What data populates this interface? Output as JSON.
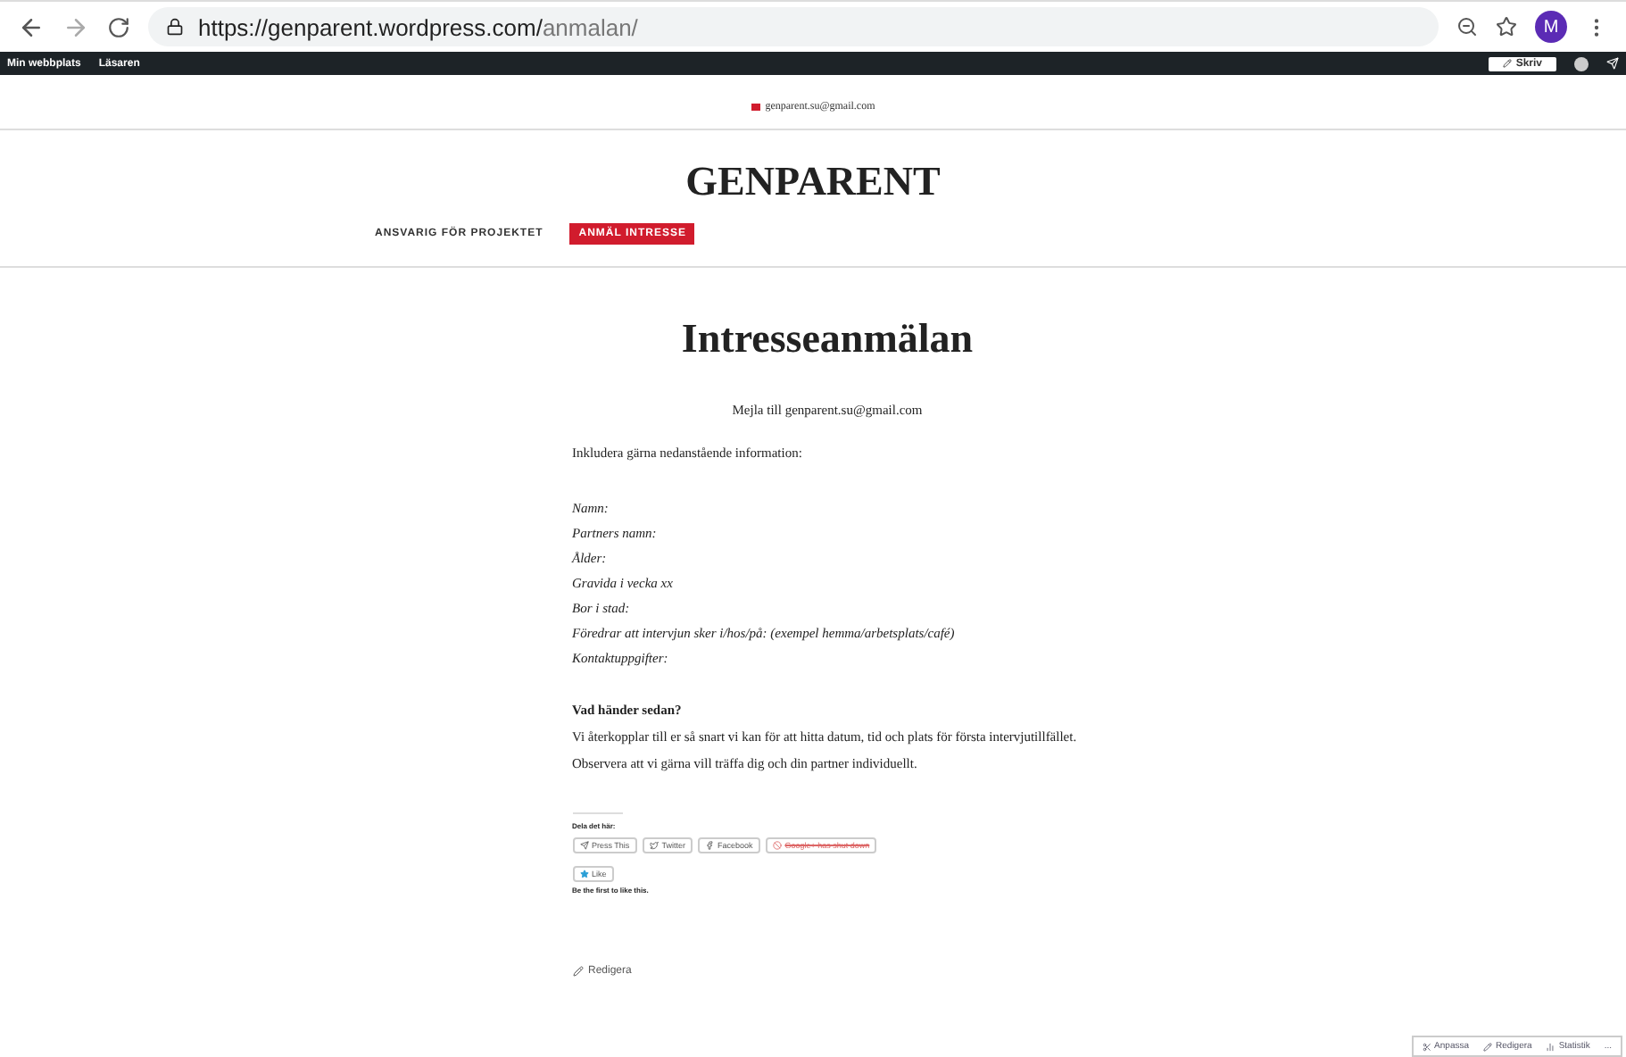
{
  "browser": {
    "url_host": "https://genparent.wordpress.com/",
    "url_path": "anmalan/",
    "avatar": "M"
  },
  "admin_bar": {
    "left": [
      "Min webbplats",
      "Läsaren"
    ],
    "write": "Skriv"
  },
  "header": {
    "email": "genparent.su@gmail.com",
    "site_title": "GENPARENT"
  },
  "nav": [
    {
      "label": "ANSVARIG FÖR PROJEKTET",
      "selected": false
    },
    {
      "label": "ANMÄL INTRESSE",
      "selected": true
    }
  ],
  "page": {
    "title": "Intresseanmälan",
    "mail_line": "Mejla till genparent.su@gmail.com",
    "intro": "Inkludera gärna nedanstående information:",
    "fields": [
      "Namn:",
      "Partners namn:",
      "Ålder:",
      "Gravida i vecka xx",
      "Bor i stad:",
      "Föredrar att intervjun sker i/hos/på: (exempel hemma/arbetsplats/café)",
      "Kontaktuppgifter:"
    ],
    "next_heading": "Vad händer sedan?",
    "next_text": "Vi återkopplar till er så snart vi kan för att hitta datum, tid och plats för första intervjutillfället. Observera att vi gärna vill träffa dig och din partner individuellt."
  },
  "share": {
    "heading": "Dela det här:",
    "buttons": [
      {
        "kind": "press",
        "label": "Press This",
        "disabled": false
      },
      {
        "kind": "twitter",
        "label": "Twitter",
        "disabled": false
      },
      {
        "kind": "facebook",
        "label": "Facebook",
        "disabled": false
      },
      {
        "kind": "google",
        "label": "Google+ has shut down",
        "disabled": true
      }
    ]
  },
  "like": {
    "button": "Like",
    "note": "Be the first to like this."
  },
  "edit_link": "Redigera",
  "footer_bar": [
    "Anpassa",
    "Redigera",
    "Statistik",
    "..."
  ]
}
